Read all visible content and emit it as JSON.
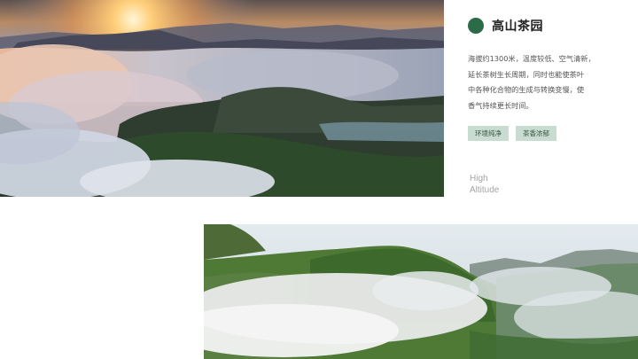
{
  "photos": {
    "top": {
      "icon": "sunrise-sea-of-clouds-photo"
    },
    "bottom": {
      "icon": "green-mountain-clouds-photo"
    }
  },
  "panel": {
    "title": "高山茶园",
    "description_lines": [
      "海拔约1300米，温度较低、空气清新，",
      "延长茶树生长周期，同时也能使茶叶",
      "中各种化合物的生成与转换变慢，使",
      "香气持续更长时间。"
    ],
    "tags": [
      "环境纯净",
      "茶香浓郁"
    ],
    "caption_lines": [
      "High",
      "Altitude"
    ]
  },
  "colors": {
    "accent": "#2c6b48",
    "tag_bg": "#c9dcd1",
    "tag_text": "#35523f",
    "caption": "#a4a4a4"
  }
}
